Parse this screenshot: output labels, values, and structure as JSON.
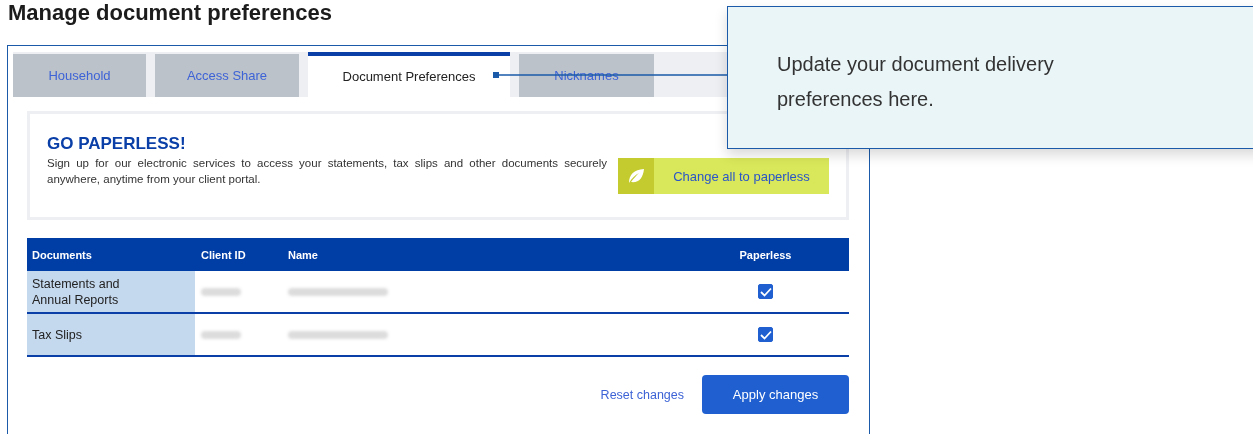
{
  "page_title": "Manage document preferences",
  "tabs": [
    {
      "label": "Household",
      "selected": false
    },
    {
      "label": "Access Share",
      "selected": false
    },
    {
      "label": "Document Preferences",
      "selected": true
    },
    {
      "label": "Nicknames",
      "selected": false
    }
  ],
  "banner": {
    "title": "GO PAPERLESS!",
    "text": "Sign up for our electronic services to access your statements, tax slips and other documents securely anywhere, anytime from your client portal.",
    "button": "Change all to paperless"
  },
  "table": {
    "columns": [
      "Documents",
      "Client ID",
      "Name",
      "Paperless"
    ],
    "rows": [
      {
        "document": "Statements and Annual Reports",
        "paperless": true
      },
      {
        "document": "Tax Slips",
        "paperless": true
      }
    ]
  },
  "actions": {
    "reset": "Reset changes",
    "apply": "Apply changes"
  },
  "callout": {
    "text": "Update your document delivery preferences here."
  }
}
